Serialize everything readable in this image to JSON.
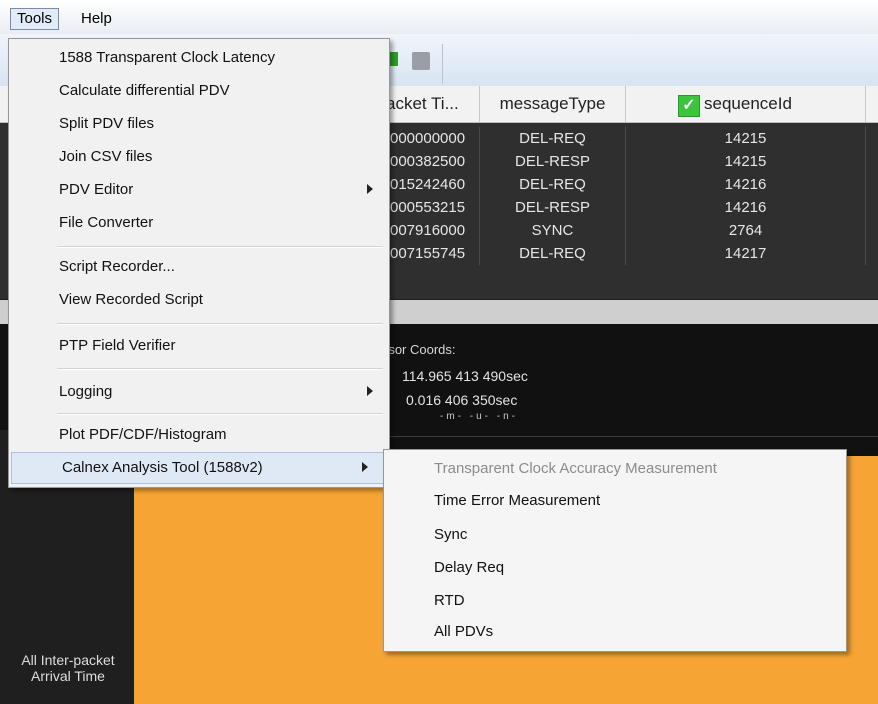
{
  "menubar": {
    "tools": "Tools",
    "help": "Help"
  },
  "table": {
    "headers": [
      "acket Ti...",
      "messageType",
      "sequenceId"
    ],
    "rows": [
      [
        "000000000",
        "DEL-REQ",
        "14215"
      ],
      [
        "000382500",
        "DEL-RESP",
        "14215"
      ],
      [
        "015242460",
        "DEL-REQ",
        "14216"
      ],
      [
        "000553215",
        "DEL-RESP",
        "14216"
      ],
      [
        "007916000",
        "SYNC",
        "2764"
      ],
      [
        "007155745",
        "DEL-REQ",
        "14217"
      ]
    ]
  },
  "plot": {
    "cursor_title": "rsor Coords:",
    "cursor_x": "114.965 413 490sec",
    "cursor_y": "0.016 406 350sec",
    "cursor_units": "-m- -u- -n-",
    "side_label": "All Inter-packet Arrival Time"
  },
  "tools_menu": {
    "items": [
      "1588 Transparent Clock Latency",
      "Calculate differential PDV",
      "Split PDV files",
      "Join CSV files",
      "PDV Editor",
      "File Converter",
      "Script Recorder...",
      "View Recorded Script",
      "PTP Field Verifier",
      "Logging",
      "Plot PDF/CDF/Histogram",
      "Calnex Analysis Tool (1588v2)"
    ]
  },
  "submenu": {
    "items": [
      "Transparent Clock Accuracy Measurement",
      "Time Error Measurement",
      "Sync",
      "Delay Req",
      "RTD",
      "All PDVs"
    ]
  },
  "colors": {
    "accent": "#f6a534",
    "check": "#3cc43c"
  }
}
